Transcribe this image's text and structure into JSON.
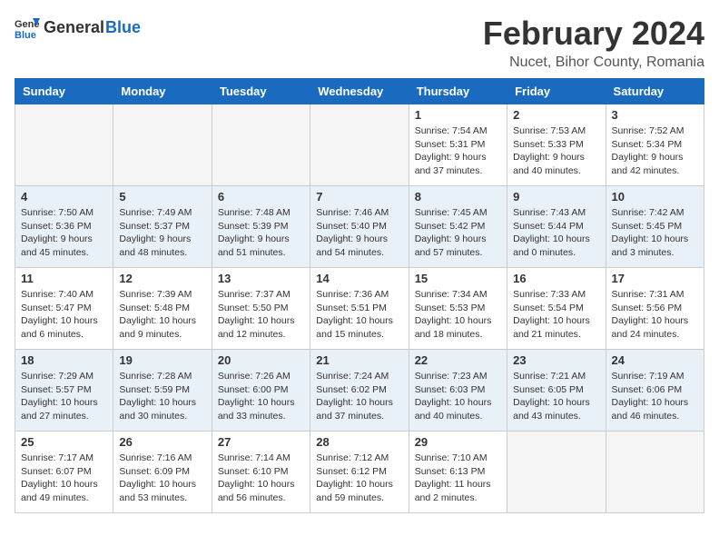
{
  "logo": {
    "text_general": "General",
    "text_blue": "Blue"
  },
  "header": {
    "month_year": "February 2024",
    "location": "Nucet, Bihor County, Romania"
  },
  "weekdays": [
    "Sunday",
    "Monday",
    "Tuesday",
    "Wednesday",
    "Thursday",
    "Friday",
    "Saturday"
  ],
  "weeks": [
    {
      "shaded": false,
      "days": [
        {
          "num": "",
          "info": ""
        },
        {
          "num": "",
          "info": ""
        },
        {
          "num": "",
          "info": ""
        },
        {
          "num": "",
          "info": ""
        },
        {
          "num": "1",
          "info": "Sunrise: 7:54 AM\nSunset: 5:31 PM\nDaylight: 9 hours\nand 37 minutes."
        },
        {
          "num": "2",
          "info": "Sunrise: 7:53 AM\nSunset: 5:33 PM\nDaylight: 9 hours\nand 40 minutes."
        },
        {
          "num": "3",
          "info": "Sunrise: 7:52 AM\nSunset: 5:34 PM\nDaylight: 9 hours\nand 42 minutes."
        }
      ]
    },
    {
      "shaded": true,
      "days": [
        {
          "num": "4",
          "info": "Sunrise: 7:50 AM\nSunset: 5:36 PM\nDaylight: 9 hours\nand 45 minutes."
        },
        {
          "num": "5",
          "info": "Sunrise: 7:49 AM\nSunset: 5:37 PM\nDaylight: 9 hours\nand 48 minutes."
        },
        {
          "num": "6",
          "info": "Sunrise: 7:48 AM\nSunset: 5:39 PM\nDaylight: 9 hours\nand 51 minutes."
        },
        {
          "num": "7",
          "info": "Sunrise: 7:46 AM\nSunset: 5:40 PM\nDaylight: 9 hours\nand 54 minutes."
        },
        {
          "num": "8",
          "info": "Sunrise: 7:45 AM\nSunset: 5:42 PM\nDaylight: 9 hours\nand 57 minutes."
        },
        {
          "num": "9",
          "info": "Sunrise: 7:43 AM\nSunset: 5:44 PM\nDaylight: 10 hours\nand 0 minutes."
        },
        {
          "num": "10",
          "info": "Sunrise: 7:42 AM\nSunset: 5:45 PM\nDaylight: 10 hours\nand 3 minutes."
        }
      ]
    },
    {
      "shaded": false,
      "days": [
        {
          "num": "11",
          "info": "Sunrise: 7:40 AM\nSunset: 5:47 PM\nDaylight: 10 hours\nand 6 minutes."
        },
        {
          "num": "12",
          "info": "Sunrise: 7:39 AM\nSunset: 5:48 PM\nDaylight: 10 hours\nand 9 minutes."
        },
        {
          "num": "13",
          "info": "Sunrise: 7:37 AM\nSunset: 5:50 PM\nDaylight: 10 hours\nand 12 minutes."
        },
        {
          "num": "14",
          "info": "Sunrise: 7:36 AM\nSunset: 5:51 PM\nDaylight: 10 hours\nand 15 minutes."
        },
        {
          "num": "15",
          "info": "Sunrise: 7:34 AM\nSunset: 5:53 PM\nDaylight: 10 hours\nand 18 minutes."
        },
        {
          "num": "16",
          "info": "Sunrise: 7:33 AM\nSunset: 5:54 PM\nDaylight: 10 hours\nand 21 minutes."
        },
        {
          "num": "17",
          "info": "Sunrise: 7:31 AM\nSunset: 5:56 PM\nDaylight: 10 hours\nand 24 minutes."
        }
      ]
    },
    {
      "shaded": true,
      "days": [
        {
          "num": "18",
          "info": "Sunrise: 7:29 AM\nSunset: 5:57 PM\nDaylight: 10 hours\nand 27 minutes."
        },
        {
          "num": "19",
          "info": "Sunrise: 7:28 AM\nSunset: 5:59 PM\nDaylight: 10 hours\nand 30 minutes."
        },
        {
          "num": "20",
          "info": "Sunrise: 7:26 AM\nSunset: 6:00 PM\nDaylight: 10 hours\nand 33 minutes."
        },
        {
          "num": "21",
          "info": "Sunrise: 7:24 AM\nSunset: 6:02 PM\nDaylight: 10 hours\nand 37 minutes."
        },
        {
          "num": "22",
          "info": "Sunrise: 7:23 AM\nSunset: 6:03 PM\nDaylight: 10 hours\nand 40 minutes."
        },
        {
          "num": "23",
          "info": "Sunrise: 7:21 AM\nSunset: 6:05 PM\nDaylight: 10 hours\nand 43 minutes."
        },
        {
          "num": "24",
          "info": "Sunrise: 7:19 AM\nSunset: 6:06 PM\nDaylight: 10 hours\nand 46 minutes."
        }
      ]
    },
    {
      "shaded": false,
      "days": [
        {
          "num": "25",
          "info": "Sunrise: 7:17 AM\nSunset: 6:07 PM\nDaylight: 10 hours\nand 49 minutes."
        },
        {
          "num": "26",
          "info": "Sunrise: 7:16 AM\nSunset: 6:09 PM\nDaylight: 10 hours\nand 53 minutes."
        },
        {
          "num": "27",
          "info": "Sunrise: 7:14 AM\nSunset: 6:10 PM\nDaylight: 10 hours\nand 56 minutes."
        },
        {
          "num": "28",
          "info": "Sunrise: 7:12 AM\nSunset: 6:12 PM\nDaylight: 10 hours\nand 59 minutes."
        },
        {
          "num": "29",
          "info": "Sunrise: 7:10 AM\nSunset: 6:13 PM\nDaylight: 11 hours\nand 2 minutes."
        },
        {
          "num": "",
          "info": ""
        },
        {
          "num": "",
          "info": ""
        }
      ]
    }
  ]
}
